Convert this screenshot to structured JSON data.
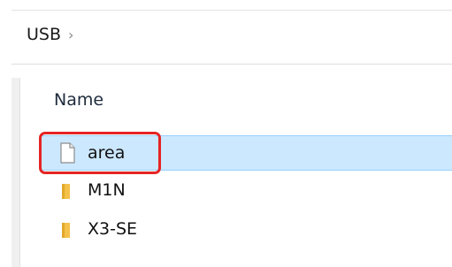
{
  "address_bar": {
    "breadcrumb": "USB",
    "separator": "›"
  },
  "file_list": {
    "column_header": "Name",
    "items": [
      {
        "name": "area",
        "type": "file",
        "icon": "file-icon",
        "selected": true
      },
      {
        "name": "M1N",
        "type": "folder",
        "icon": "folder-icon",
        "selected": false
      },
      {
        "name": "X3-SE",
        "type": "folder",
        "icon": "folder-icon",
        "selected": false
      }
    ]
  },
  "colors": {
    "selection_background": "#cce8ff",
    "selection_border": "#99d1ff",
    "annotation": "#e52424",
    "folder": "#f4c14a"
  }
}
